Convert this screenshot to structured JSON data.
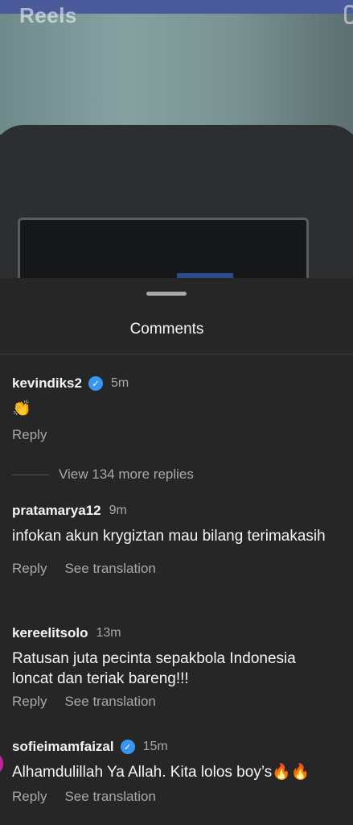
{
  "video": {
    "title": "Reels"
  },
  "comments_sheet": {
    "title": "Comments",
    "view_more_replies": "View 134 more replies",
    "comments": [
      {
        "username": "kevindiks2",
        "verified": true,
        "time": "5m",
        "text": "👏",
        "actions": [
          "Reply"
        ]
      },
      {
        "username": "pratamarya12",
        "verified": false,
        "time": "9m",
        "text": "infokan akun krygiztan mau bilang terimakasih",
        "actions": [
          "Reply",
          "See translation"
        ]
      },
      {
        "username": "kereelitsolo",
        "verified": false,
        "time": "13m",
        "text": "Ratusan juta pecinta sepakbola Indonesia loncat dan teriak bareng!!!",
        "actions": [
          "Reply",
          "See translation"
        ]
      },
      {
        "username": "sofieimamfaizal",
        "verified": true,
        "time": "15m",
        "text": "Alhamdulillah Ya Allah. Kita lolos boy’s🔥🔥",
        "actions": [
          "Reply",
          "See translation"
        ]
      }
    ]
  },
  "colors": {
    "background": "#262626",
    "secondary_text": "#a8a8a8",
    "verified_badge": "#3797f0"
  }
}
